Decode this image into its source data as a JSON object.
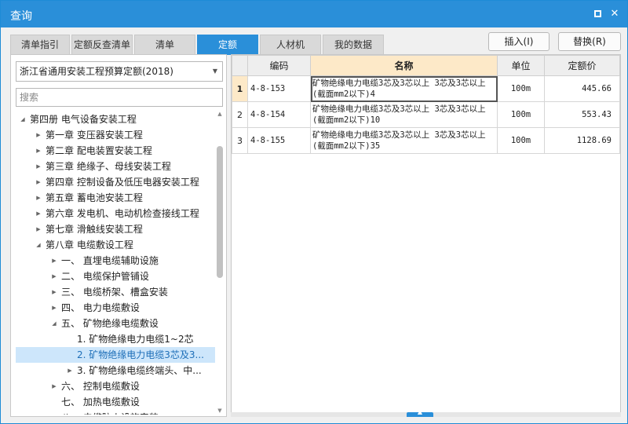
{
  "window": {
    "title": "查询",
    "maximize_label": "□",
    "close_label": "✕"
  },
  "tabs": [
    {
      "label": "清单指引",
      "active": false
    },
    {
      "label": "定额反查清单",
      "active": false
    },
    {
      "label": "清单",
      "active": false
    },
    {
      "label": "定额",
      "active": true
    },
    {
      "label": "人材机",
      "active": false
    },
    {
      "label": "我的数据",
      "active": false
    }
  ],
  "actions": {
    "insert_label": "插入(I)",
    "replace_label": "替换(R)"
  },
  "left": {
    "selected_library": "浙江省通用安装工程预算定额(2018)",
    "search_placeholder": "搜索",
    "tree": [
      {
        "label": "第四册  电气设备安装工程",
        "level": 0,
        "arrow": "◢",
        "selected": false
      },
      {
        "label": "第一章  变压器安装工程",
        "level": 1,
        "arrow": "▶",
        "selected": false
      },
      {
        "label": "第二章  配电装置安装工程",
        "level": 1,
        "arrow": "▶",
        "selected": false
      },
      {
        "label": "第三章  绝缘子、母线安装工程",
        "level": 1,
        "arrow": "▶",
        "selected": false
      },
      {
        "label": "第四章  控制设备及低压电器安装工程",
        "level": 1,
        "arrow": "▶",
        "selected": false
      },
      {
        "label": "第五章  蓄电池安装工程",
        "level": 1,
        "arrow": "▶",
        "selected": false
      },
      {
        "label": "第六章  发电机、电动机检查接线工程",
        "level": 1,
        "arrow": "▶",
        "selected": false
      },
      {
        "label": "第七章  滑触线安装工程",
        "level": 1,
        "arrow": "▶",
        "selected": false
      },
      {
        "label": "第八章  电缆敷设工程",
        "level": 1,
        "arrow": "◢",
        "selected": false
      },
      {
        "label": "一、  直埋电缆辅助设施",
        "level": 2,
        "arrow": "▶",
        "selected": false
      },
      {
        "label": "二、  电缆保护管铺设",
        "level": 2,
        "arrow": "▶",
        "selected": false
      },
      {
        "label": "三、  电缆桥架、槽盒安装",
        "level": 2,
        "arrow": "▶",
        "selected": false
      },
      {
        "label": "四、  电力电缆敷设",
        "level": 2,
        "arrow": "▶",
        "selected": false
      },
      {
        "label": "五、  矿物绝缘电缆敷设",
        "level": 2,
        "arrow": "◢",
        "selected": false
      },
      {
        "label": "1. 矿物绝缘电力电缆1~2芯",
        "level": 3,
        "arrow": "",
        "selected": false
      },
      {
        "label": "2. 矿物绝缘电力电缆3芯及3...",
        "level": 3,
        "arrow": "",
        "selected": true
      },
      {
        "label": "3. 矿物绝缘电缆终端头、中...",
        "level": 3,
        "arrow": "▶",
        "selected": false
      },
      {
        "label": "六、  控制电缆敷设",
        "level": 2,
        "arrow": "▶",
        "selected": false
      },
      {
        "label": "七、  加热电缆敷设",
        "level": 2,
        "arrow": "",
        "selected": false
      },
      {
        "label": "八、  电缆防火设施安装",
        "level": 2,
        "arrow": "▶",
        "selected": false
      }
    ]
  },
  "grid": {
    "columns": [
      {
        "key": "num",
        "label": ""
      },
      {
        "key": "code",
        "label": "编码"
      },
      {
        "key": "name",
        "label": "名称"
      },
      {
        "key": "unit",
        "label": "单位"
      },
      {
        "key": "price",
        "label": "定额价"
      }
    ],
    "rows": [
      {
        "num": "1",
        "code": "4-8-153",
        "name": "矿物绝缘电力电缆3芯及3芯以上 3芯及3芯以上(截面mm2以下)4",
        "unit": "100m",
        "price": "445.66",
        "current": true
      },
      {
        "num": "2",
        "code": "4-8-154",
        "name": "矿物绝缘电力电缆3芯及3芯以上 3芯及3芯以上(截面mm2以下)10",
        "unit": "100m",
        "price": "553.43",
        "current": false
      },
      {
        "num": "3",
        "code": "4-8-155",
        "name": "矿物绝缘电力电缆3芯及3芯以上 3芯及3芯以上(截面mm2以下)35",
        "unit": "100m",
        "price": "1128.69",
        "current": false
      }
    ]
  },
  "colors": {
    "accent": "#2a8fd9",
    "selected_row": "#cde6fb",
    "header_highlight": "#fde9c8"
  },
  "icons": {
    "expanded": "chevron-down-icon",
    "collapsed": "chevron-right-icon",
    "dropdown": "caret-down-icon"
  }
}
